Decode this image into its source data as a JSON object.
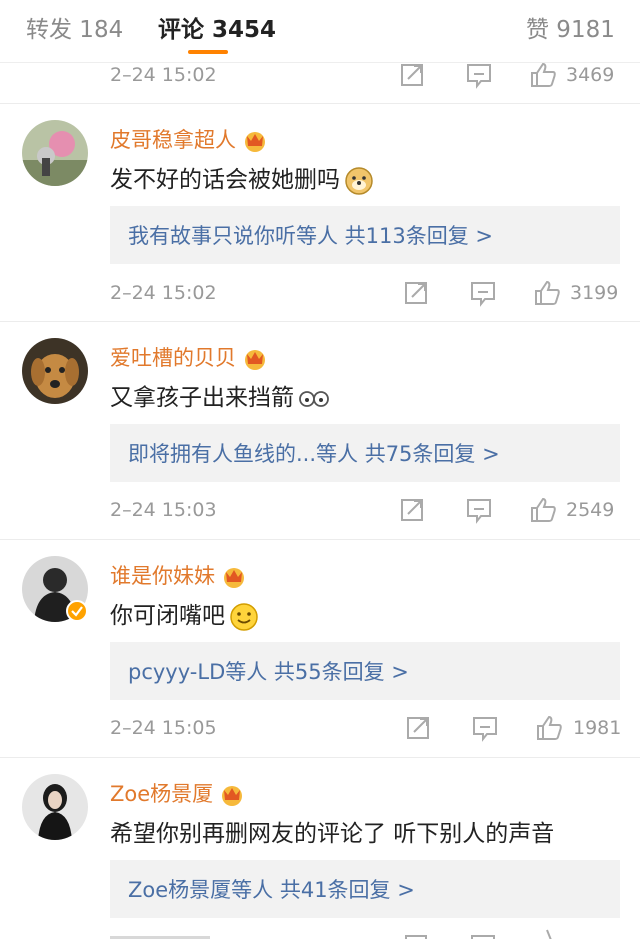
{
  "tabs": {
    "repost": "转发 184",
    "comments": "评论 3454",
    "likes": "赞 9181"
  },
  "first_meta": {
    "time": "2–24 15:02",
    "likes": "3469"
  },
  "comments": [
    {
      "user": "皮哥稳拿超人",
      "text": "发不好的话会被她删吗",
      "reply": "我有故事只说你听等人  共113条回复 >",
      "time": "2–24 15:02",
      "likes": "3199"
    },
    {
      "user": "爱吐槽的贝贝",
      "text": "又拿孩子出来挡箭",
      "reply": "即将拥有人鱼线的...等人  共75条回复 >",
      "time": "2–24 15:03",
      "likes": "2549"
    },
    {
      "user": "谁是你妹妹",
      "text": "你可闭嘴吧",
      "reply": "pcyyy-LD等人  共55条回复 >",
      "time": "2–24 15:05",
      "likes": "1981"
    },
    {
      "user": "Zoe杨景厦",
      "text": "希望你别再删网友的评论了 听下别人的声音",
      "reply": "Zoe杨景厦等人  共41条回复 >"
    }
  ],
  "colors": {
    "accent": "#ff8200",
    "username": "#e1792c",
    "reply_link": "#4a6fa5",
    "meta": "#999999"
  },
  "icons": [
    "repost-icon",
    "comment-icon",
    "like-icon",
    "crown-badge-icon",
    "verified-badge-icon"
  ]
}
